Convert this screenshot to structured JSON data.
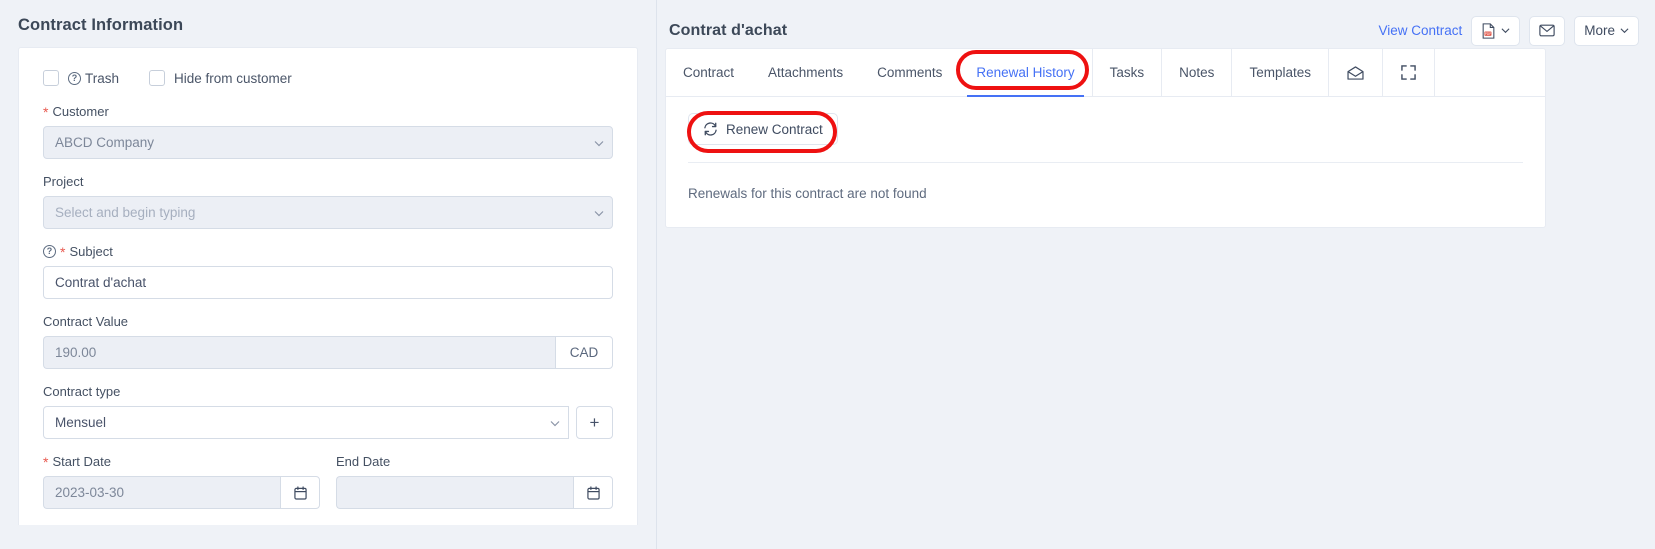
{
  "left": {
    "title": "Contract Information",
    "checkboxes": [
      {
        "label": "Trash",
        "has_help_icon": true,
        "checked": false
      },
      {
        "label": "Hide from customer",
        "has_help_icon": false,
        "checked": false
      }
    ],
    "fields": {
      "customer": {
        "label": "Customer",
        "required": true,
        "value": "ABCD Company",
        "disabled": true
      },
      "project": {
        "label": "Project",
        "required": false,
        "placeholder": "Select and begin typing",
        "disabled": true
      },
      "subject": {
        "label": "Subject",
        "required": true,
        "value": "Contrat d'achat",
        "has_help_icon": true
      },
      "contract_value": {
        "label": "Contract Value",
        "required": false,
        "value": "190.00",
        "currency": "CAD",
        "disabled": true
      },
      "contract_type": {
        "label": "Contract type",
        "required": false,
        "value": "Mensuel",
        "add_button": "+"
      },
      "start_date": {
        "label": "Start Date",
        "required": true,
        "value": "2023-03-30"
      },
      "end_date": {
        "label": "End Date",
        "required": false,
        "value": ""
      }
    }
  },
  "right": {
    "title": "Contrat d'achat",
    "actions": {
      "view_contract": "View Contract",
      "pdf_icon": "pdf-file-icon",
      "mail_icon": "envelope-icon",
      "more_label": "More"
    },
    "tabs": [
      {
        "label": "Contract",
        "active": false
      },
      {
        "label": "Attachments",
        "active": false
      },
      {
        "label": "Comments",
        "active": false
      },
      {
        "label": "Renewal History",
        "active": true
      },
      {
        "label": "Tasks",
        "active": false
      },
      {
        "label": "Notes",
        "active": false
      },
      {
        "label": "Templates",
        "active": false
      }
    ],
    "icon_tabs": [
      {
        "icon": "open-envelope-icon"
      },
      {
        "icon": "expand-icon"
      }
    ],
    "renew_button": "Renew Contract",
    "empty_message": "Renewals for this contract are not found"
  },
  "colors": {
    "accent_blue": "#4571f5",
    "annotation_red": "#ee1111",
    "page_bg": "#eff2f7",
    "text_dark": "#3c4858",
    "required_red": "#e8594f"
  }
}
